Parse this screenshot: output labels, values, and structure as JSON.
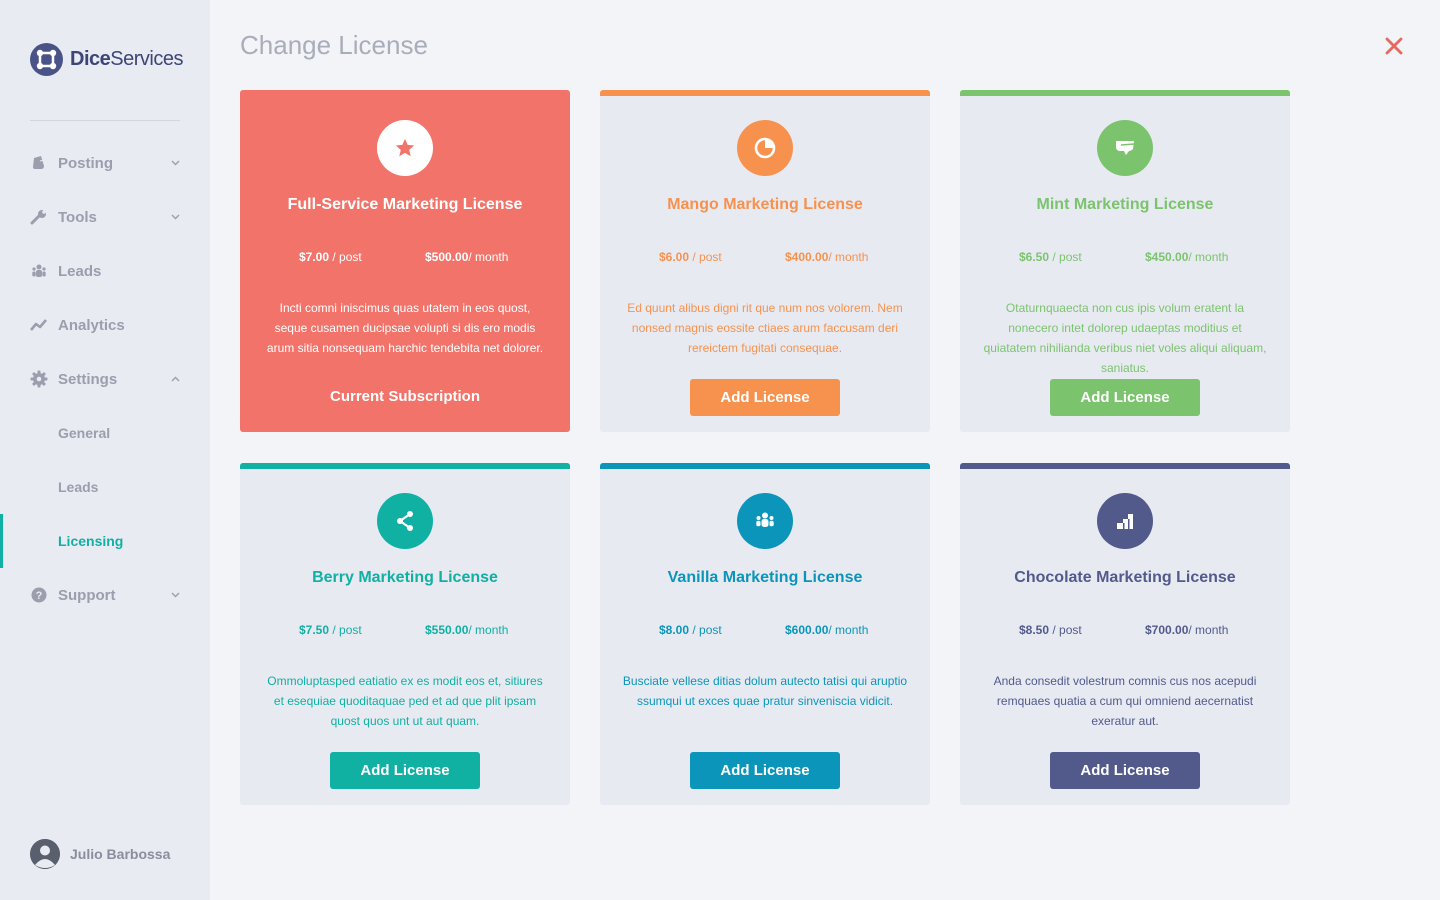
{
  "app": {
    "logo_bold": "Dice",
    "logo_light": "Services"
  },
  "sidebar": {
    "items": [
      {
        "label": "Posting",
        "icon": "document-icon"
      },
      {
        "label": "Tools",
        "icon": "wrench-icon"
      },
      {
        "label": "Leads",
        "icon": "people-icon"
      },
      {
        "label": "Analytics",
        "icon": "trend-icon"
      },
      {
        "label": "Settings",
        "icon": "gear-icon"
      }
    ],
    "settings_sub": [
      {
        "label": "General"
      },
      {
        "label": "Leads"
      },
      {
        "label": "Licensing",
        "active": true
      }
    ],
    "support": {
      "label": "Support",
      "icon": "help-icon"
    }
  },
  "user": {
    "name": "Julio Barbossa"
  },
  "page": {
    "title": "Change License"
  },
  "licenses": [
    {
      "name": "Full-Service Marketing License",
      "per_post": "$7.00",
      "per_post_unit": " / post",
      "per_month": "$500.00",
      "per_month_unit": "/ month",
      "description": "Incti comni iniscimus quas utatem in eos quost, seque cusamen ducipsae volupti si dis ero modis arum sitia nonsequam harchic tendebita net dolorer.",
      "action": "Current Subscription",
      "color": "#f2736a",
      "icon": "star-icon",
      "current": true
    },
    {
      "name": "Mango Marketing License",
      "per_post": "$6.00",
      "per_post_unit": " / post",
      "per_month": "$400.00",
      "per_month_unit": "/ month",
      "description": "Ed quunt alibus digni rit que num nos volorem. Nem nonsed magnis eossite ctiaes arum faccusam deri rereictem fugitati consequae.",
      "action": "Add License",
      "color": "#f7924e",
      "icon": "pie-chart-icon"
    },
    {
      "name": "Mint Marketing License",
      "per_post": "$6.50",
      "per_post_unit": " / post",
      "per_month": "$450.00",
      "per_month_unit": "/ month",
      "description": "Otaturnquaecta non cus ipis volum eratent la nonecero intet dolorep udaeptas moditius et quiatatem nihilianda veribus niet voles aliqui aliquam, saniatus.",
      "action": "Add License",
      "color": "#7cc36e",
      "icon": "chat-bubble-icon"
    },
    {
      "name": "Berry Marketing License",
      "per_post": "$7.50",
      "per_post_unit": " / post",
      "per_month": "$550.00",
      "per_month_unit": "/ month",
      "description": "Ommoluptasped eatiatio ex es modit eos et, sitiures et esequiae quoditaquae ped et ad que plit ipsam quost quos unt ut aut quam.",
      "action": "Add License",
      "color": "#10b0a3",
      "icon": "share-icon"
    },
    {
      "name": "Vanilla Marketing License",
      "per_post": "$8.00",
      "per_post_unit": " / post",
      "per_month": "$600.00",
      "per_month_unit": "/ month",
      "description": "Busciate vellese ditias dolum autecto tatisi qui aruptio ssumqui ut exces quae pratur sinveniscia vidicit.",
      "action": "Add License",
      "color": "#0c95ba",
      "icon": "group-icon"
    },
    {
      "name": "Chocolate Marketing License",
      "per_post": "$8.50",
      "per_post_unit": " / post",
      "per_month": "$700.00",
      "per_month_unit": "/ month",
      "description": "Anda consedit volestrum comnis cus nos acepudi remquaes quatia a cum qui omniend aecernatist exeratur aut.",
      "action": "Add License",
      "color": "#525a8c",
      "icon": "bar-steps-icon"
    }
  ]
}
